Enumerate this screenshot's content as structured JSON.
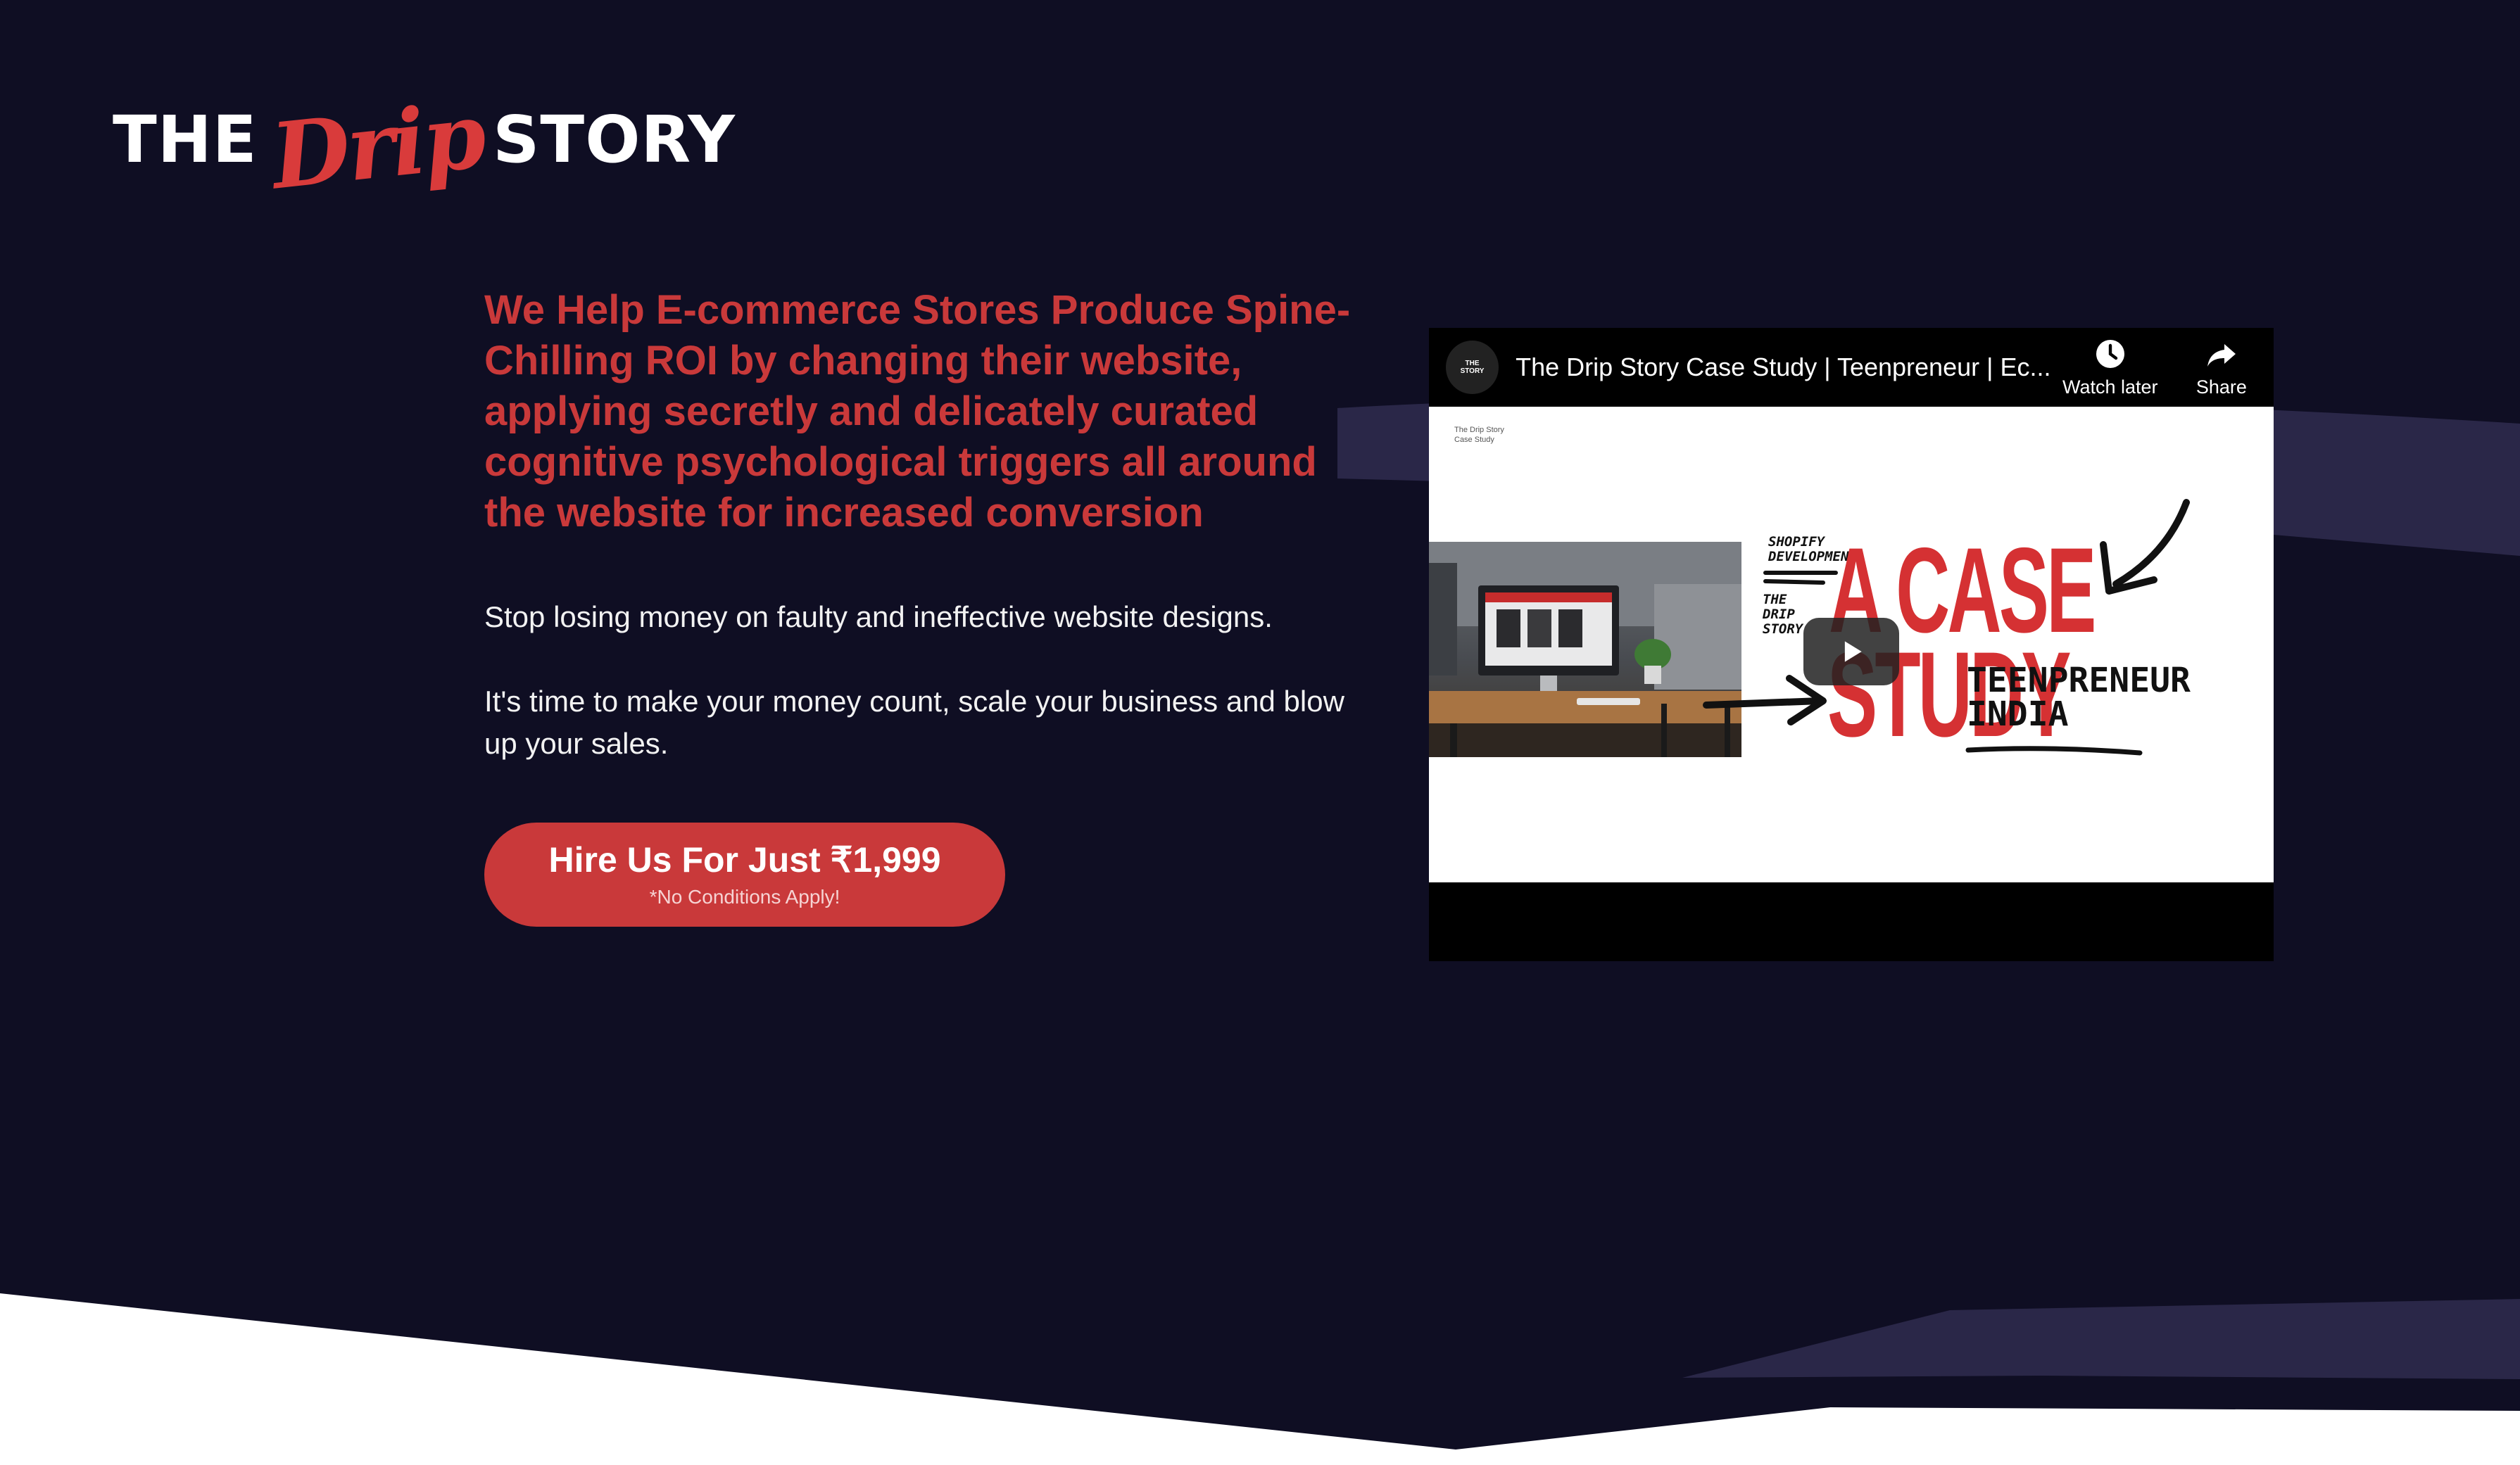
{
  "brand": {
    "word_left": "THE",
    "word_script": "Drip",
    "word_right": "STORY"
  },
  "hero": {
    "headline": "We Help E-commerce Stores Produce Spine-Chilling ROI by changing their website, applying secretly and delicately curated cognitive psychological triggers all around the website for increased conversion",
    "paragraph_1": "Stop losing money on faulty and ineffective website designs.",
    "paragraph_2": "It's time to make your money count, scale your business and blow up your sales.",
    "cta_main": "Hire Us For Just ₹1,999",
    "cta_sub": "*No Conditions Apply!"
  },
  "video": {
    "title": "The Drip Story Case Study | Teenpreneur | Ec...",
    "watch_later_label": "Watch later",
    "share_label": "Share",
    "channel_avatar_text": "THE STORY",
    "thumbnail": {
      "corner_note_1": "The Drip Story",
      "corner_note_2": "Case Study",
      "label_shopify_1": "SHOPIFY",
      "label_shopify_2": "DEVELOPMENT",
      "label_tds_1": "THE",
      "label_tds_2": "DRIP",
      "label_tds_3": "STORY",
      "big_line_1": "A CASE",
      "big_line_2": "STUDY",
      "brush_line_1": "TEENPRENEUR",
      "brush_line_2": "INDIA"
    }
  },
  "colors": {
    "background": "#0f0e23",
    "accent": "#c9393a",
    "text": "#f2f2f2",
    "swoosh": "#2a2748"
  },
  "icons": [
    "clock-icon",
    "share-arrow-icon",
    "play-icon"
  ]
}
